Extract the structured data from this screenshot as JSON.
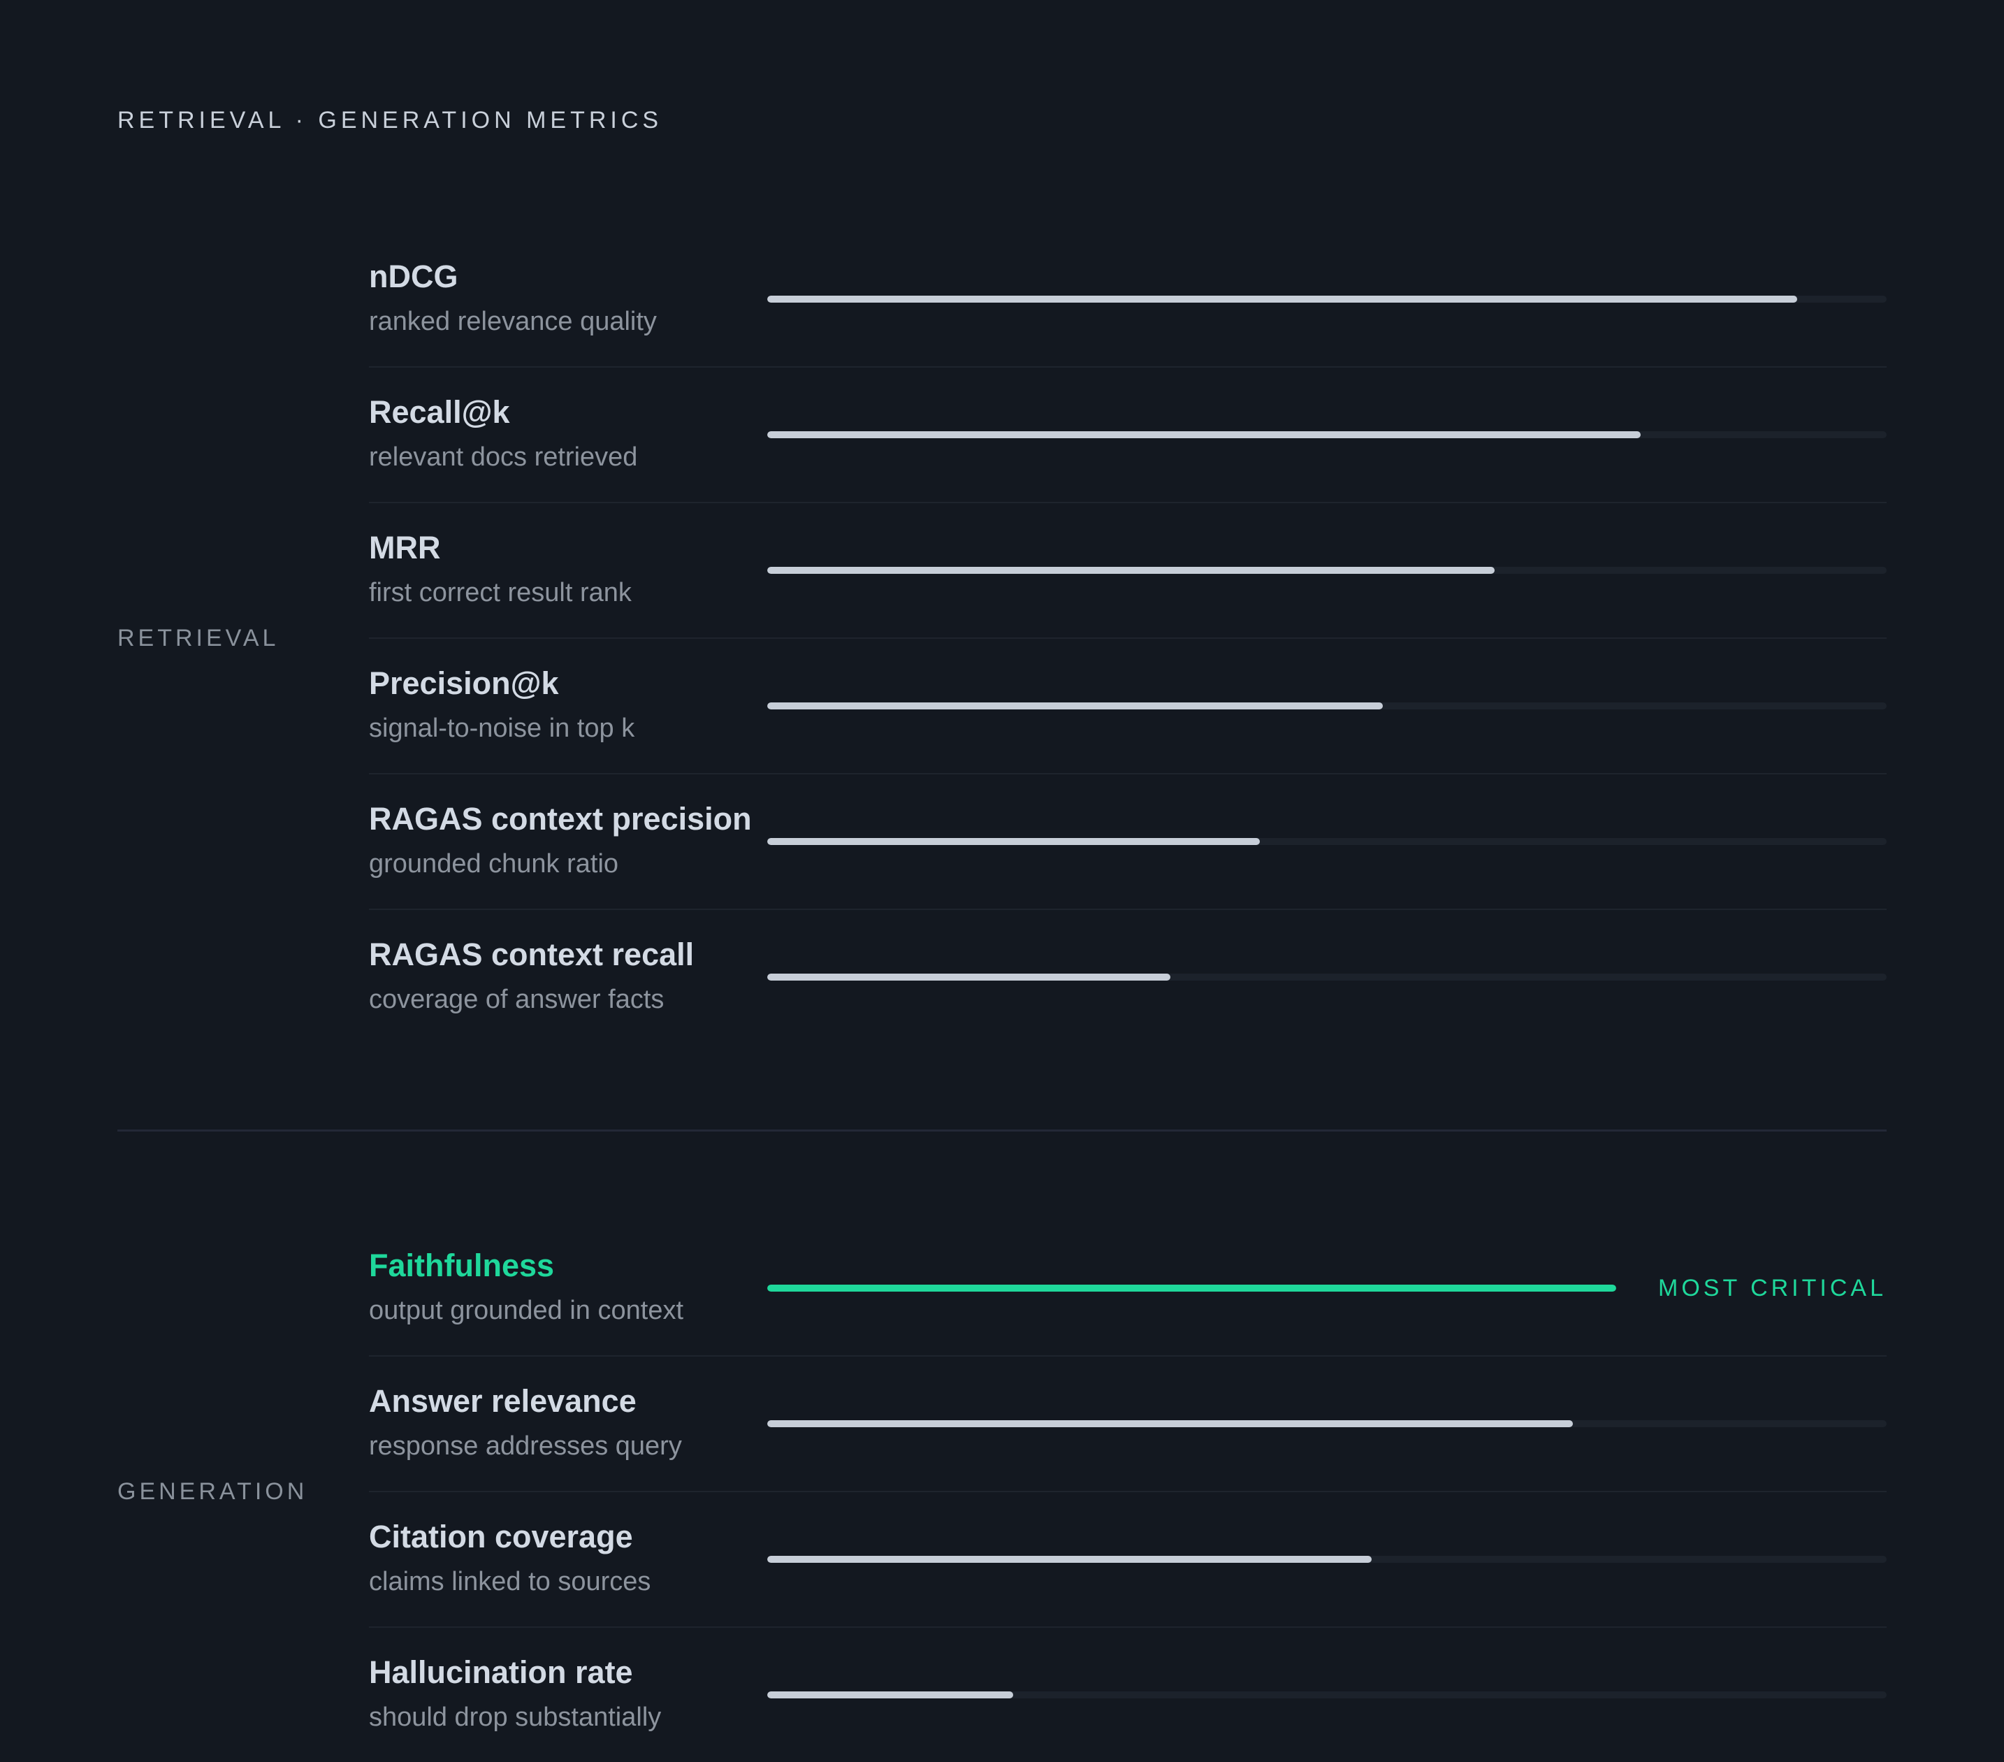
{
  "header": {
    "title": "RETRIEVAL · GENERATION METRICS"
  },
  "sections": [
    {
      "label": "RETRIEVAL",
      "metrics": [
        {
          "name": "nDCG",
          "description": "ranked relevance quality",
          "level": 0.92
        },
        {
          "name": "Recall@k",
          "description": "relevant docs retrieved",
          "level": 0.78
        },
        {
          "name": "MRR",
          "description": "first correct result rank",
          "level": 0.65
        },
        {
          "name": "Precision@k",
          "description": "signal-to-noise in top k",
          "level": 0.55
        },
        {
          "name": "RAGAS context precision",
          "description": "grounded chunk ratio",
          "level": 0.44
        },
        {
          "name": "RAGAS context recall",
          "description": "coverage of answer facts",
          "level": 0.36
        }
      ]
    },
    {
      "label": "GENERATION",
      "metrics": [
        {
          "name": "Faithfulness",
          "description": "output grounded in context",
          "level": 1.0,
          "highlight": true,
          "tag": "MOST CRITICAL"
        },
        {
          "name": "Answer relevance",
          "description": "response addresses query",
          "level": 0.72
        },
        {
          "name": "Citation coverage",
          "description": "claims linked to sources",
          "level": 0.54
        },
        {
          "name": "Hallucination rate",
          "description": "should drop substantially",
          "level": 0.22
        }
      ]
    }
  ],
  "colors": {
    "background": "#131820",
    "bar_fill": "#c7ced8",
    "bar_track": "#1c222b",
    "accent": "#1fd89b"
  }
}
